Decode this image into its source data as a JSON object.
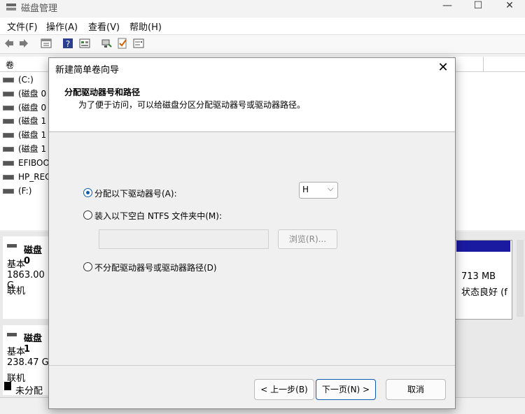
{
  "window": {
    "title": "磁盘管理",
    "minimize": "—",
    "maximize": "☐",
    "close": "✕"
  },
  "menu": [
    {
      "label": "文件(F)"
    },
    {
      "label": "操作(A)"
    },
    {
      "label": "查看(V)"
    },
    {
      "label": "帮助(H)"
    }
  ],
  "toolbar": {
    "icons": [
      "back-icon",
      "forward-icon",
      "properties-icon",
      "help-icon",
      "list-icon",
      "connect-icon",
      "check-icon",
      "settings-icon"
    ]
  },
  "volume_list": {
    "column": "卷",
    "items": [
      {
        "label": "(C:)"
      },
      {
        "label": "(磁盘 0"
      },
      {
        "label": "(磁盘 0"
      },
      {
        "label": "(磁盘 1"
      },
      {
        "label": "(磁盘 1"
      },
      {
        "label": "(磁盘 1"
      },
      {
        "label": "EFIBOO"
      },
      {
        "label": "HP_REC"
      },
      {
        "label": "(F:)"
      }
    ]
  },
  "disks": [
    {
      "name": "磁盘 0",
      "type": "基本",
      "size": "1863.00 G",
      "status": "联机"
    },
    {
      "name": "磁盘 1",
      "type": "基本",
      "size": "238.47 G",
      "status": "联机"
    }
  ],
  "partition": {
    "size": "713 MB",
    "status": "状态良好 (f"
  },
  "legend": {
    "unallocated": "未分配"
  },
  "dialog": {
    "title": "新建简单卷向导",
    "close": "✕",
    "header_title": "分配驱动器号和路径",
    "header_subtitle": "为了便于访问，可以给磁盘分区分配驱动器号或驱动器路径。",
    "option_assign": "分配以下驱动器号(A):",
    "option_mount": "装入以下空白 NTFS 文件夹中(M):",
    "option_none": "不分配驱动器号或驱动器路径(D)",
    "drive_letter": "H",
    "folder_path": "",
    "browse": "浏览(R)...",
    "back": "< 上一步(B)",
    "next": "下一页(N) >",
    "cancel": "取消"
  },
  "colors": {
    "accent": "#0b5cad",
    "partition_bar": "#1a1aa0"
  }
}
